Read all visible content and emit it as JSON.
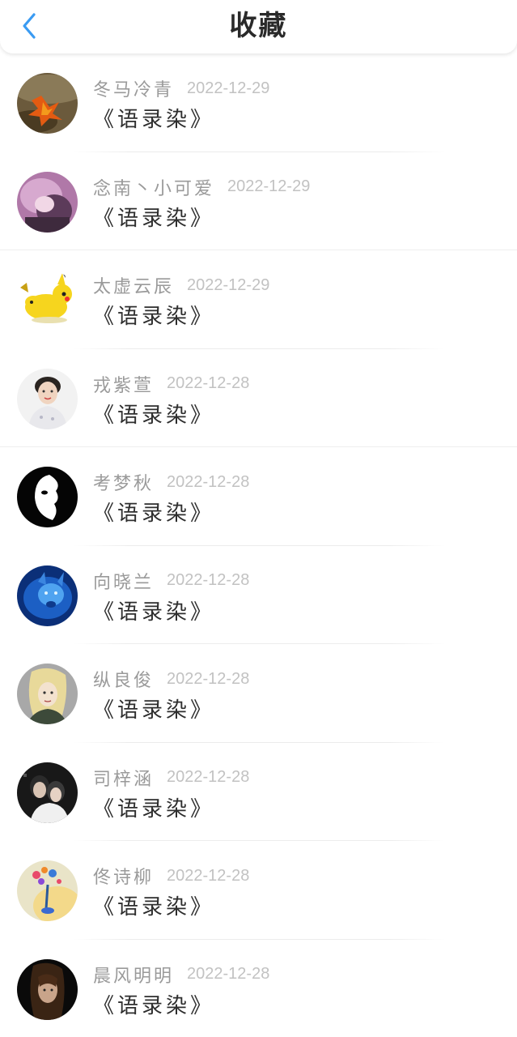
{
  "header": {
    "title": "收藏",
    "back_icon": "chevron-left-icon",
    "back_color": "#3a9bf2"
  },
  "favorites": [
    {
      "name": "冬马冷青",
      "date": "2022-12-29",
      "title": "《语录染》"
    },
    {
      "name": "念南丶小可爱",
      "date": "2022-12-29",
      "title": "《语录染》"
    },
    {
      "name": "太虚云辰",
      "date": "2022-12-29",
      "title": "《语录染》"
    },
    {
      "name": "戎紫萱",
      "date": "2022-12-28",
      "title": "《语录染》"
    },
    {
      "name": "考梦秋",
      "date": "2022-12-28",
      "title": "《语录染》"
    },
    {
      "name": "向晓兰",
      "date": "2022-12-28",
      "title": "《语录染》"
    },
    {
      "name": "纵良俊",
      "date": "2022-12-28",
      "title": "《语录染》"
    },
    {
      "name": "司梓涵",
      "date": "2022-12-28",
      "title": "《语录染》"
    },
    {
      "name": "佟诗柳",
      "date": "2022-12-28",
      "title": "《语录染》"
    },
    {
      "name": "晨风明明",
      "date": "2022-12-28",
      "title": "《语录染》"
    }
  ]
}
